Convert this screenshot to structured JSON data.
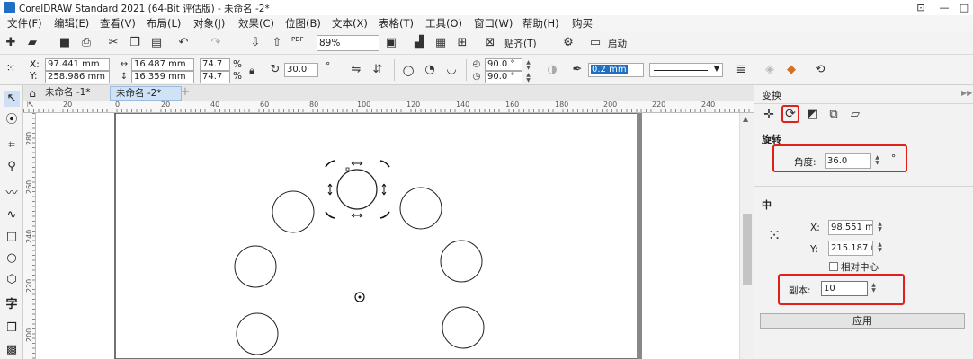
{
  "window": {
    "title": "CorelDRAW Standard 2021 (64-Bit 评估版) - 未命名 -2*",
    "controls": [
      "⊡",
      "—",
      "□"
    ]
  },
  "menu": {
    "items": [
      "文件(F)",
      "编辑(E)",
      "查看(V)",
      "布局(L)",
      "对象(J)",
      "效果(C)",
      "位图(B)",
      "文本(X)",
      "表格(T)",
      "工具(O)",
      "窗口(W)",
      "帮助(H)",
      "购买"
    ]
  },
  "toolbar": {
    "zoom": "89%",
    "align_label": "贴齐(T)",
    "launch_label": "启动",
    "pdf_label": "PDF"
  },
  "property_bar": {
    "x_label": "X:",
    "y_label": "Y:",
    "x": "97.441 mm",
    "y": "258.986 mm",
    "width": "16.487 mm",
    "height": "16.359 mm",
    "scale_x": "74.7",
    "scale_y": "74.7",
    "percent": "%",
    "rotation": "30.0",
    "degree_symbol": "°",
    "arc_start": "90.0 °",
    "arc_end": "90.0 °",
    "outline_width": "0.2 mm"
  },
  "tabs": [
    {
      "label": "未命名 -1*"
    },
    {
      "label": "未命名 -2*"
    }
  ],
  "ruler": {
    "h_ticks": [
      "20",
      "0",
      "20",
      "40",
      "60",
      "80",
      "100",
      "120",
      "140",
      "160",
      "180",
      "200",
      "220",
      "240"
    ],
    "v_ticks": [
      "280",
      "260",
      "240",
      "220",
      "200"
    ]
  },
  "docker": {
    "title": "变换",
    "rotate_section": "旋转",
    "angle_label": "角度:",
    "angle_value": "36.0",
    "degree_symbol": "°",
    "center_section": "中",
    "x_label": "X:",
    "x_value": "98.551 mm",
    "y_label": "Y:",
    "y_value": "215.187 mi",
    "relative_center_label": "相对中心",
    "copies_label": "副本:",
    "copies_value": "10",
    "apply_label": "应用"
  },
  "colors": {
    "highlight": "#e0201a",
    "accent": "#1f6fc5"
  }
}
